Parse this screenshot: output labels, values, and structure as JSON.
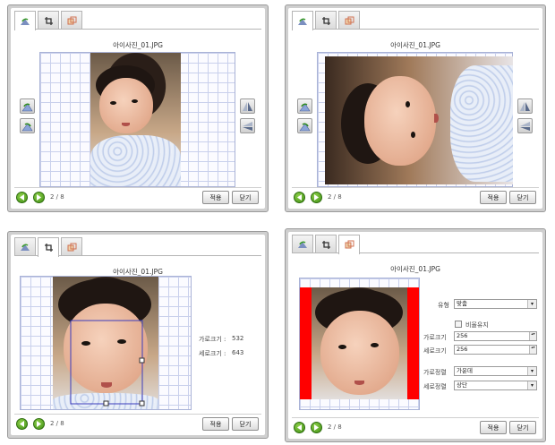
{
  "windows": [
    {
      "filename": "아이사진_01.JPG",
      "page": "2 / 8",
      "apply": "적용",
      "close": "닫기",
      "active_tab": 0
    },
    {
      "filename": "아이사진_01.JPG",
      "page": "2 / 8",
      "apply": "적용",
      "close": "닫기",
      "active_tab": 0
    },
    {
      "filename": "아이사진_01.JPG",
      "page": "2 / 8",
      "apply": "적용",
      "close": "닫기",
      "active_tab": 1,
      "crop": {
        "width_label": "가로크기 :",
        "width_value": "532",
        "height_label": "세로크기 :",
        "height_value": "643"
      }
    },
    {
      "filename": "아이사진_01.JPG",
      "page": "2 / 8",
      "apply": "적용",
      "close": "닫기",
      "active_tab": 2,
      "resize": {
        "type_label": "유형",
        "type_value": "맞춤",
        "keep_ratio_label": "비율유지",
        "width_label": "가로크기",
        "width_value": "256",
        "height_label": "세로크기",
        "height_value": "256",
        "halign_label": "가로정렬",
        "halign_value": "가운데",
        "valign_label": "세로정렬",
        "valign_value": "상단"
      }
    }
  ],
  "tabs": [
    "rotate-tab",
    "crop-tab",
    "resize-tab"
  ],
  "colors": {
    "nav_green": "#4fa51e",
    "grid_line": "#c9d0ec",
    "fill_red": "#ff0000",
    "crop_box": "#3d3dbd"
  }
}
